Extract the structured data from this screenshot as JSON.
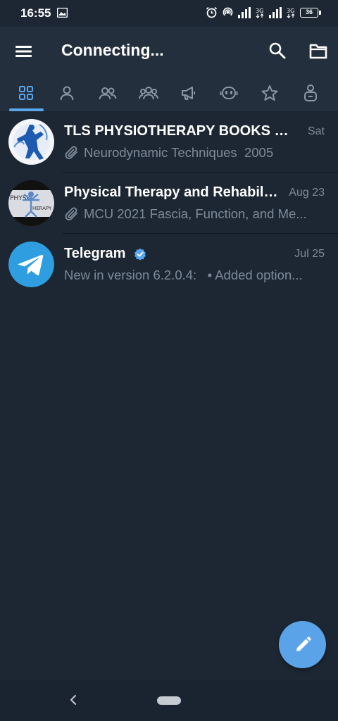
{
  "status_bar": {
    "time": "16:55",
    "battery": "36"
  },
  "header": {
    "title": "Connecting...",
    "icons": [
      "menu-icon",
      "search-icon",
      "folder-icon"
    ]
  },
  "tabs": [
    {
      "name": "all-chats",
      "icon": "grid-icon",
      "active": true
    },
    {
      "name": "private",
      "icon": "person-icon"
    },
    {
      "name": "groups",
      "icon": "two-people-icon"
    },
    {
      "name": "channels-users",
      "icon": "group-icon"
    },
    {
      "name": "channels",
      "icon": "megaphone-icon"
    },
    {
      "name": "bots",
      "icon": "bot-icon"
    },
    {
      "name": "favorites",
      "icon": "star-icon"
    },
    {
      "name": "contact",
      "icon": "contact-icon"
    }
  ],
  "chats": [
    {
      "name": "TLS PHYSIOTHERAPY BOOKS BA...",
      "date": "Sat",
      "preview_icon": "paperclip-icon",
      "preview": "Neurodynamic Techniques  2005"
    },
    {
      "name": "Physical Therapy and Rehabilit...",
      "date": "Aug 23",
      "preview_icon": "paperclip-icon",
      "preview": "MCU 2021 Fascia, Function, and Me..."
    },
    {
      "name": "Telegram",
      "date": "Jul 25",
      "verified": true,
      "preview": "New in version 6.2.0.4:   • Added option..."
    }
  ],
  "colors": {
    "background": "#1d2733",
    "header": "#242f3e",
    "accent": "#5aa7ec",
    "secondary_text": "#7d8b99",
    "fab": "#5aa3e8"
  }
}
